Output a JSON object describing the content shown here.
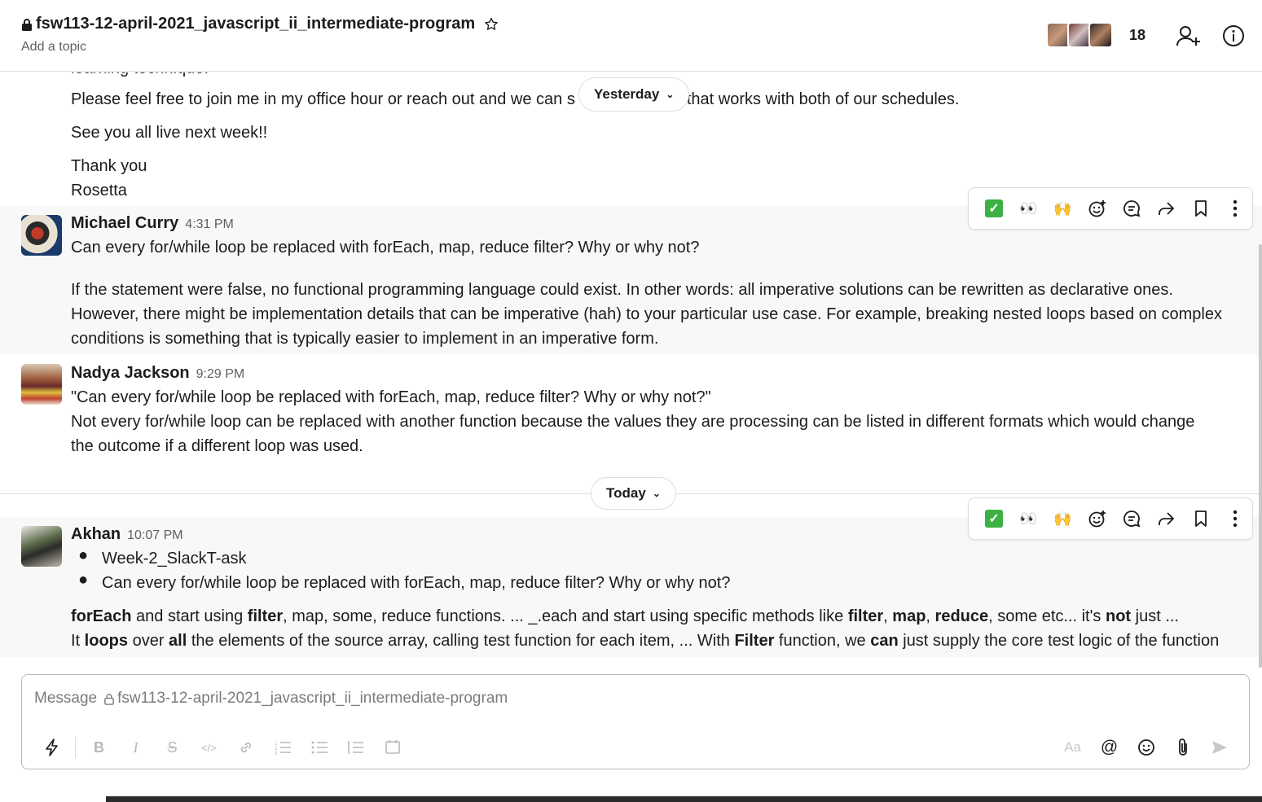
{
  "header": {
    "channel": "fsw113-12-april-2021_javascript_ii_intermediate-program",
    "topic": "Add a topic",
    "member_count": "18"
  },
  "messages": {
    "continuation": {
      "partial_line": "learning technique.",
      "line1_before": "Please feel free to join me in my office hour or reach out and we can s",
      "line1_after": "that works with both of our schedules.",
      "line2": "See you all live next week!!",
      "line3": "Thank you",
      "line4": "Rosetta"
    },
    "date_yesterday": "Yesterday",
    "michael": {
      "author": "Michael Curry",
      "time": "4:31 PM",
      "question": "Can every for/while loop be replaced with forEach, map, reduce filter? Why or why not?",
      "p1": "If the statement were false, no functional programming language could exist. In other words: all imperative solutions can be rewritten as declarative ones.",
      "p2": "However, there might be implementation details that can be imperative (hah) to your particular use case. For example, breaking nested loops based on complex",
      "p3": "conditions is something that is typically easier to implement in an imperative form."
    },
    "nadya": {
      "author": "Nadya Jackson",
      "time": "9:29 PM",
      "quote": "\"Can every for/while loop be replaced with forEach, map, reduce filter? Why or why not?\"",
      "p1": "Not every for/while loop can be replaced with another function because the values they are processing can be listed in different formats which would change",
      "p2": "the outcome if a different loop was used."
    },
    "date_today": "Today",
    "akhan": {
      "author": "Akhan",
      "time": "10:07 PM",
      "bullet1": "Week-2_SlackT-ask",
      "bullet2": "Can every for/while loop be replaced with forEach, map, reduce filter? Why or why not?",
      "l1": [
        {
          "t": "forEach",
          "b": true
        },
        {
          "t": " and start using ",
          "b": false
        },
        {
          "t": "filter",
          "b": true
        },
        {
          "t": ", map, some, reduce functions. ... _.each and start using specific methods like ",
          "b": false
        },
        {
          "t": "filter",
          "b": true
        },
        {
          "t": ", ",
          "b": false
        },
        {
          "t": "map",
          "b": true
        },
        {
          "t": ", ",
          "b": false
        },
        {
          "t": "reduce",
          "b": true
        },
        {
          "t": ", some etc... it's ",
          "b": false
        },
        {
          "t": "not",
          "b": true
        },
        {
          "t": " just ...",
          "b": false
        }
      ],
      "l2": [
        {
          "t": "It ",
          "b": false
        },
        {
          "t": "loops",
          "b": true
        },
        {
          "t": " over ",
          "b": false
        },
        {
          "t": "all",
          "b": true
        },
        {
          "t": " the elements of the source array, calling test function for each item, ... With ",
          "b": false
        },
        {
          "t": "Filter",
          "b": true
        },
        {
          "t": " function, we ",
          "b": false
        },
        {
          "t": "can",
          "b": true
        },
        {
          "t": " just supply the core test logic of the function",
          "b": false
        }
      ]
    }
  },
  "actions": {
    "check": "✓",
    "eyes": "👀",
    "raised_hands": "🙌"
  },
  "composer": {
    "placeholder_prefix": "Message",
    "placeholder_channel": "fsw113-12-april-2021_javascript_ii_intermediate-program",
    "format_label": "Aa"
  },
  "colors": {
    "check_green": "#3cb043",
    "hover_bg": "#f8f8f8"
  }
}
